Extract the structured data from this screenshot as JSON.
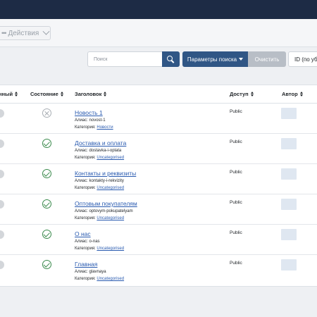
{
  "toolbar": {
    "actions_label": "Действия"
  },
  "filters": {
    "search_placeholder": "Поиск",
    "params_label": "Параметры поиска",
    "clear_label": "Очистить",
    "sort_value": "ID (по убыванию)"
  },
  "table": {
    "headers": {
      "featured": "нный",
      "state": "Состояние",
      "title": "Заголовок",
      "access": "Доступ",
      "author": "Автор"
    },
    "rows": [
      {
        "state": "unpublished",
        "title": "Новость 1",
        "alias_label": "Алиас:",
        "alias": "novost-1",
        "category_label": "Категория:",
        "category": "Новости",
        "access": "Public"
      },
      {
        "state": "published",
        "title": "Доставка и оплата",
        "alias_label": "Алиас:",
        "alias": "dostavka-i-oplata",
        "category_label": "Категория:",
        "category": "Uncategorised",
        "access": "Public"
      },
      {
        "state": "published",
        "title": "Контакты и реквизиты",
        "alias_label": "Алиас:",
        "alias": "kontakty-i-rekvizity",
        "category_label": "Категория:",
        "category": "Uncategorised",
        "access": "Public"
      },
      {
        "state": "published",
        "title": "Оптовым покупателям",
        "alias_label": "Алиас:",
        "alias": "optovym-pokupatelyam",
        "category_label": "Категория:",
        "category": "Uncategorised",
        "access": "Public"
      },
      {
        "state": "published",
        "title": "О нас",
        "alias_label": "Алиас:",
        "alias": "o-nas",
        "category_label": "Категория:",
        "category": "Uncategorised",
        "access": "Public"
      },
      {
        "state": "published",
        "title": "Главная",
        "alias_label": "Алиас:",
        "alias": "glavnaya",
        "category_label": "Категория:",
        "category": "Uncategorised",
        "access": "Public"
      }
    ]
  }
}
